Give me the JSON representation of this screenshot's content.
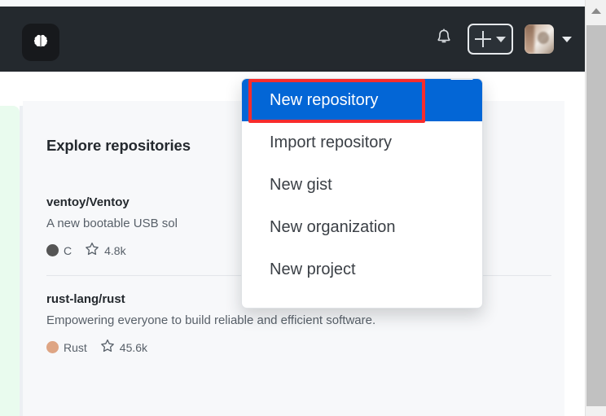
{
  "header": {
    "logo_icon": "brain-icon",
    "notifications_icon": "bell-icon",
    "create_new_icon": "plus-icon",
    "create_new_caret_icon": "chevron-down-icon",
    "avatar_icon": "user-avatar",
    "avatar_caret_icon": "chevron-down-icon",
    "background_color": "#24292e"
  },
  "dropdown": {
    "accent_color": "#0366d6",
    "items": [
      {
        "label": "New repository",
        "active": true
      },
      {
        "label": "Import repository",
        "active": false
      },
      {
        "label": "New gist",
        "active": false
      },
      {
        "label": "New organization",
        "active": false
      },
      {
        "label": "New project",
        "active": false
      }
    ]
  },
  "annotation": {
    "color": "#f82c2c",
    "target": "New repository"
  },
  "main": {
    "explore_title": "Explore repositories",
    "repositories": [
      {
        "name": "ventoy/Ventoy",
        "description": "A new bootable USB sol",
        "language": "C",
        "language_color": "#555555",
        "stars": "4.8k",
        "star_icon": "star-icon"
      },
      {
        "name": "rust-lang/rust",
        "description": "Empowering everyone to build reliable and efficient software.",
        "language": "Rust",
        "language_color": "#dea584",
        "stars": "45.6k",
        "star_icon": "star-icon"
      }
    ]
  },
  "scrollbar": {
    "up_arrow_icon": "triangle-up-icon"
  }
}
